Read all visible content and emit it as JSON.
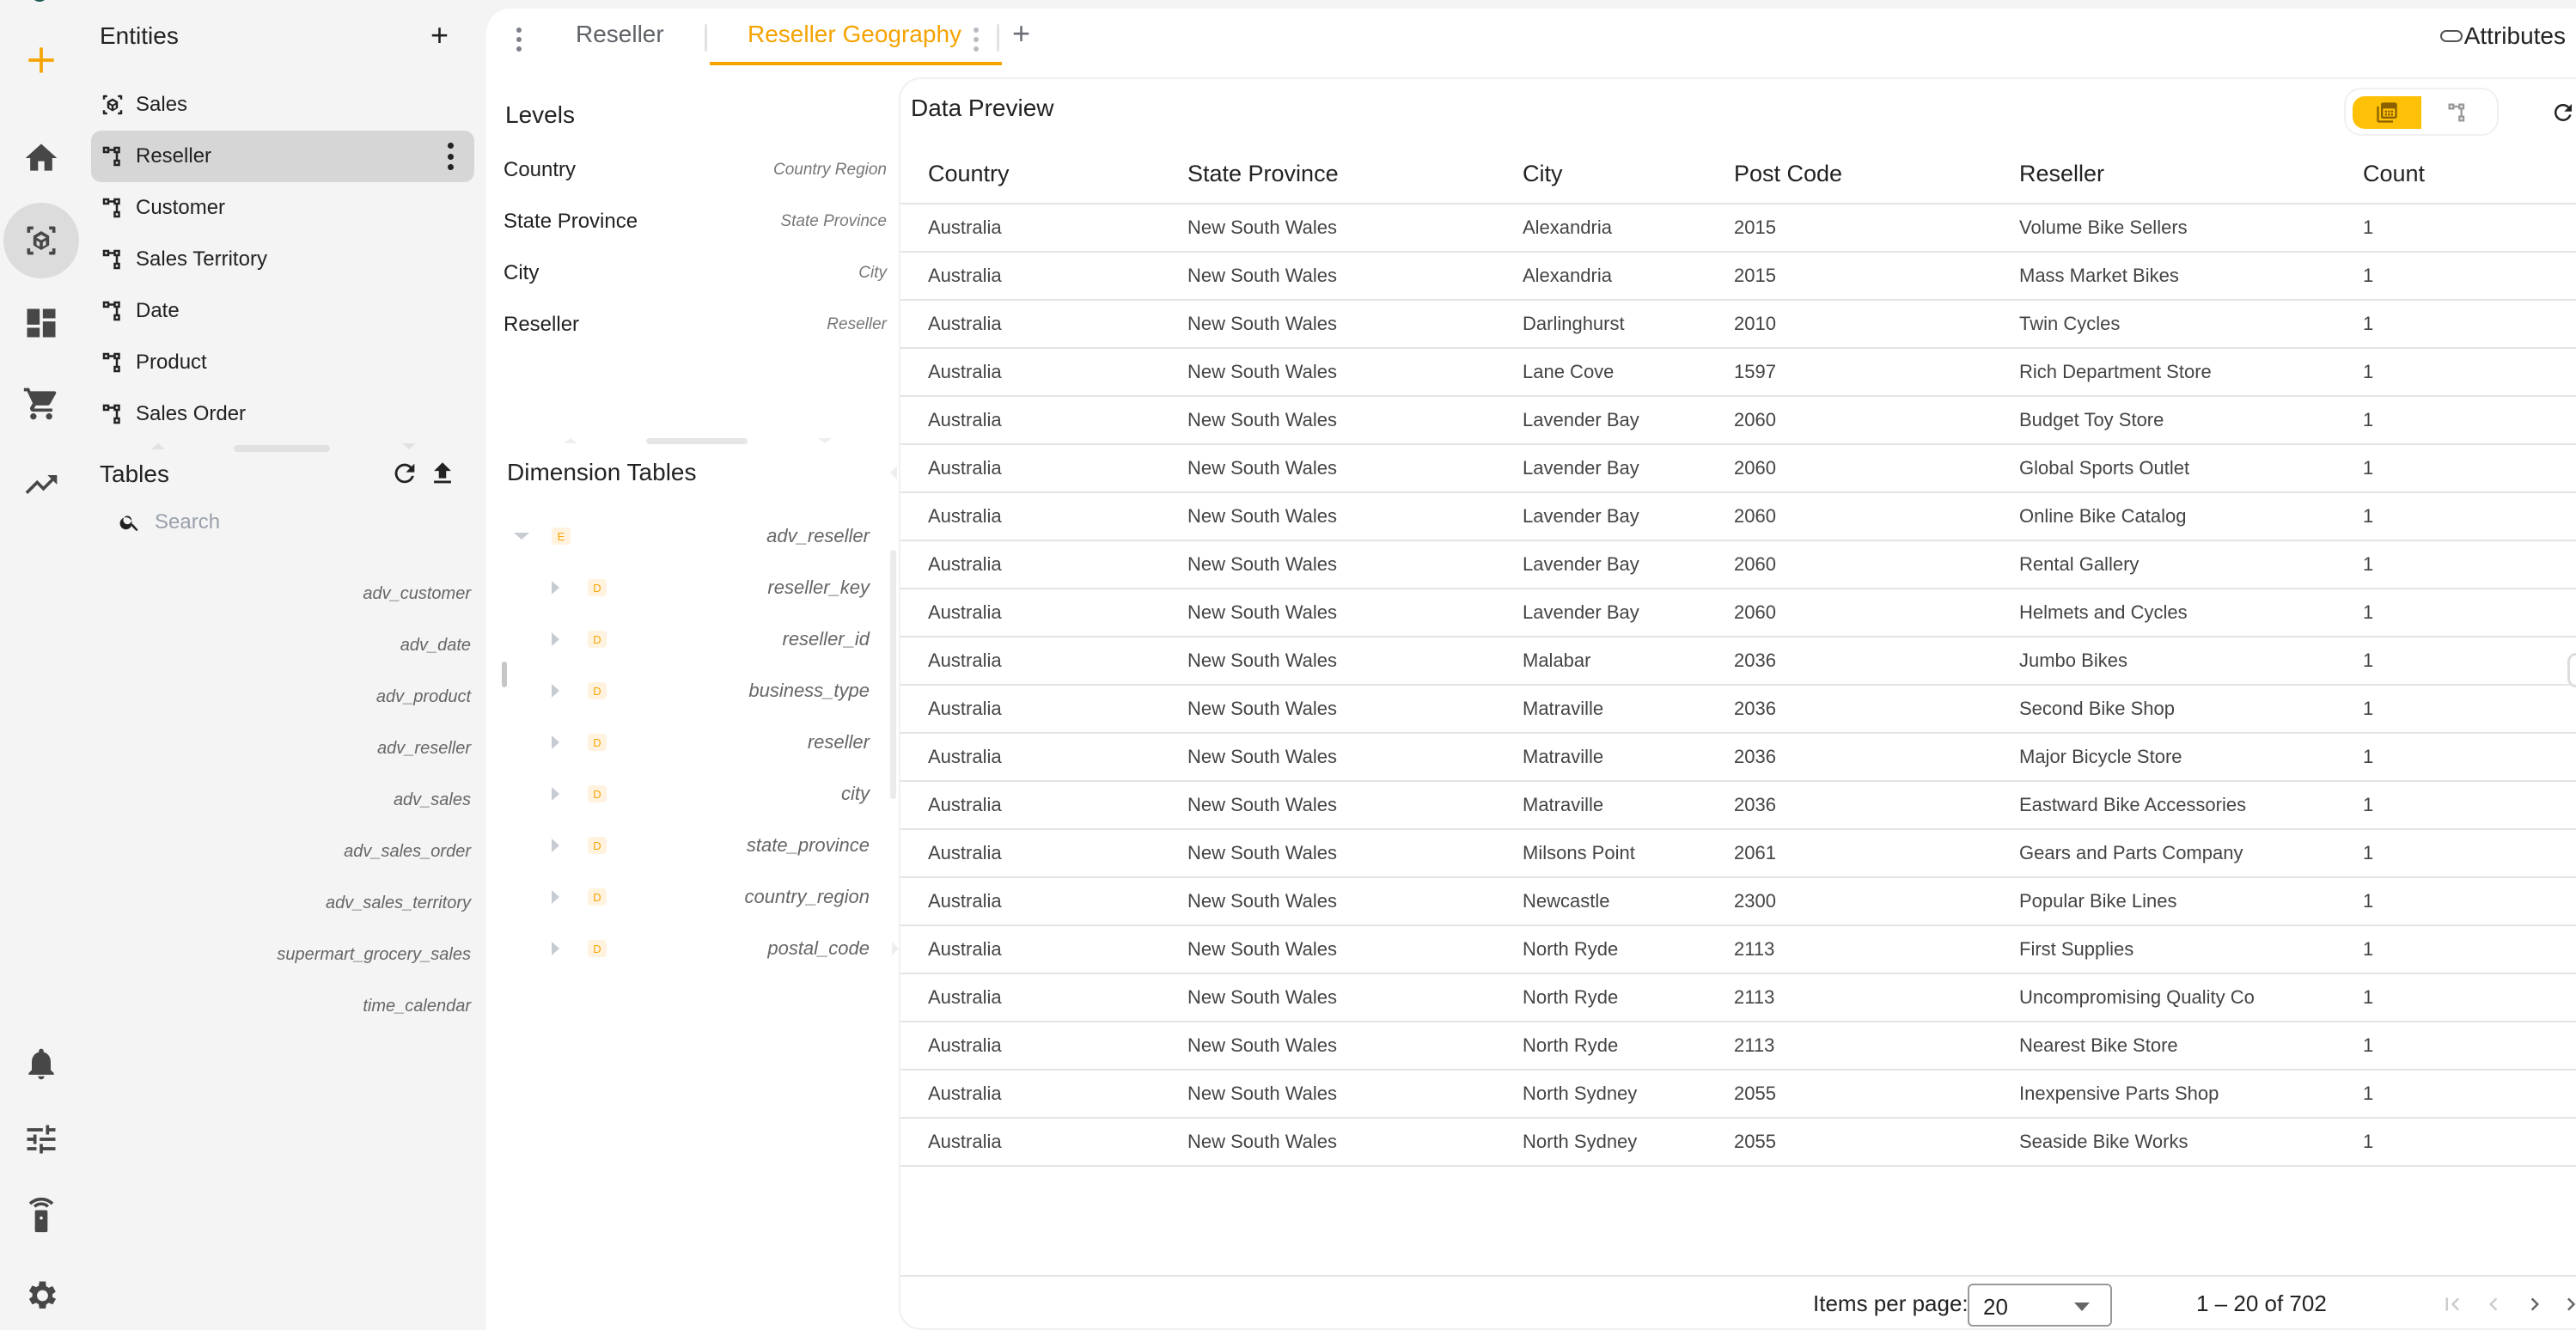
{
  "rail": {
    "items": [
      {
        "name": "add-icon"
      },
      {
        "name": "home-icon"
      },
      {
        "name": "model-icon"
      },
      {
        "name": "dashboard-icon"
      },
      {
        "name": "cart-icon"
      },
      {
        "name": "trending-icon"
      },
      {
        "name": "bell-icon"
      },
      {
        "name": "tune-icon"
      },
      {
        "name": "remote-icon"
      },
      {
        "name": "gear-icon"
      }
    ],
    "active": "model-icon",
    "accent": "#F5A300"
  },
  "entities": {
    "title": "Entities",
    "add_label": "+",
    "items": [
      {
        "label": "Sales",
        "icon": "cube-icon"
      },
      {
        "label": "Reseller",
        "icon": "hierarchy-icon",
        "selected": true
      },
      {
        "label": "Customer",
        "icon": "hierarchy-icon"
      },
      {
        "label": "Sales Territory",
        "icon": "hierarchy-icon"
      },
      {
        "label": "Date",
        "icon": "hierarchy-icon"
      },
      {
        "label": "Product",
        "icon": "hierarchy-icon"
      },
      {
        "label": "Sales Order",
        "icon": "hierarchy-icon"
      }
    ]
  },
  "tables": {
    "title": "Tables",
    "search_placeholder": "Search",
    "search_value": "",
    "items": [
      "adv_customer",
      "adv_date",
      "adv_product",
      "adv_reseller",
      "adv_sales",
      "adv_sales_order",
      "adv_sales_territory",
      "supermart_grocery_sales",
      "time_calendar"
    ]
  },
  "tabs": {
    "items": [
      "Reseller",
      "Reseller Geography"
    ],
    "active": "Reseller Geography",
    "add_label": "+",
    "attributes_label": "Attributes"
  },
  "levels": {
    "title": "Levels",
    "items": [
      {
        "name": "Country",
        "attribute": "Country Region"
      },
      {
        "name": "State Province",
        "attribute": "State Province"
      },
      {
        "name": "City",
        "attribute": "City"
      },
      {
        "name": "Reseller",
        "attribute": "Reseller"
      }
    ]
  },
  "dimension_tables": {
    "title": "Dimension Tables",
    "root": {
      "badge": "E",
      "name": "adv_reseller",
      "expanded": true
    },
    "children": [
      {
        "badge": "D",
        "name": "reseller_key"
      },
      {
        "badge": "D",
        "name": "reseller_id"
      },
      {
        "badge": "D",
        "name": "business_type"
      },
      {
        "badge": "D",
        "name": "reseller"
      },
      {
        "badge": "D",
        "name": "city"
      },
      {
        "badge": "D",
        "name": "state_province"
      },
      {
        "badge": "D",
        "name": "country_region"
      },
      {
        "badge": "D",
        "name": "postal_code"
      }
    ]
  },
  "preview": {
    "title": "Data Preview",
    "view_modes": [
      "table-view-icon",
      "hierarchy-view-icon"
    ],
    "active_view": "table-view-icon",
    "columns": [
      "Country",
      "State Province",
      "City",
      "Post Code",
      "Reseller",
      "Count"
    ],
    "rows": [
      [
        "Australia",
        "New South Wales",
        "Alexandria",
        "2015",
        "Volume Bike Sellers",
        "1"
      ],
      [
        "Australia",
        "New South Wales",
        "Alexandria",
        "2015",
        "Mass Market Bikes",
        "1"
      ],
      [
        "Australia",
        "New South Wales",
        "Darlinghurst",
        "2010",
        "Twin Cycles",
        "1"
      ],
      [
        "Australia",
        "New South Wales",
        "Lane Cove",
        "1597",
        "Rich Department Store",
        "1"
      ],
      [
        "Australia",
        "New South Wales",
        "Lavender Bay",
        "2060",
        "Budget Toy Store",
        "1"
      ],
      [
        "Australia",
        "New South Wales",
        "Lavender Bay",
        "2060",
        "Global Sports Outlet",
        "1"
      ],
      [
        "Australia",
        "New South Wales",
        "Lavender Bay",
        "2060",
        "Online Bike Catalog",
        "1"
      ],
      [
        "Australia",
        "New South Wales",
        "Lavender Bay",
        "2060",
        "Rental Gallery",
        "1"
      ],
      [
        "Australia",
        "New South Wales",
        "Lavender Bay",
        "2060",
        "Helmets and Cycles",
        "1"
      ],
      [
        "Australia",
        "New South Wales",
        "Malabar",
        "2036",
        "Jumbo Bikes",
        "1"
      ],
      [
        "Australia",
        "New South Wales",
        "Matraville",
        "2036",
        "Second Bike Shop",
        "1"
      ],
      [
        "Australia",
        "New South Wales",
        "Matraville",
        "2036",
        "Major Bicycle Store",
        "1"
      ],
      [
        "Australia",
        "New South Wales",
        "Matraville",
        "2036",
        "Eastward Bike Accessories",
        "1"
      ],
      [
        "Australia",
        "New South Wales",
        "Milsons Point",
        "2061",
        "Gears and Parts Company",
        "1"
      ],
      [
        "Australia",
        "New South Wales",
        "Newcastle",
        "2300",
        "Popular Bike Lines",
        "1"
      ],
      [
        "Australia",
        "New South Wales",
        "North Ryde",
        "2113",
        "First Supplies",
        "1"
      ],
      [
        "Australia",
        "New South Wales",
        "North Ryde",
        "2113",
        "Uncompromising Quality Co",
        "1"
      ],
      [
        "Australia",
        "New South Wales",
        "North Ryde",
        "2113",
        "Nearest Bike Store",
        "1"
      ],
      [
        "Australia",
        "New South Wales",
        "North Sydney",
        "2055",
        "Inexpensive Parts Shop",
        "1"
      ],
      [
        "Australia",
        "New South Wales",
        "North Sydney",
        "2055",
        "Seaside Bike Works",
        "1"
      ]
    ],
    "pagination": {
      "items_per_page_label": "Items per page:",
      "items_per_page": "20",
      "range_label": "1 – 20 of 702"
    }
  }
}
